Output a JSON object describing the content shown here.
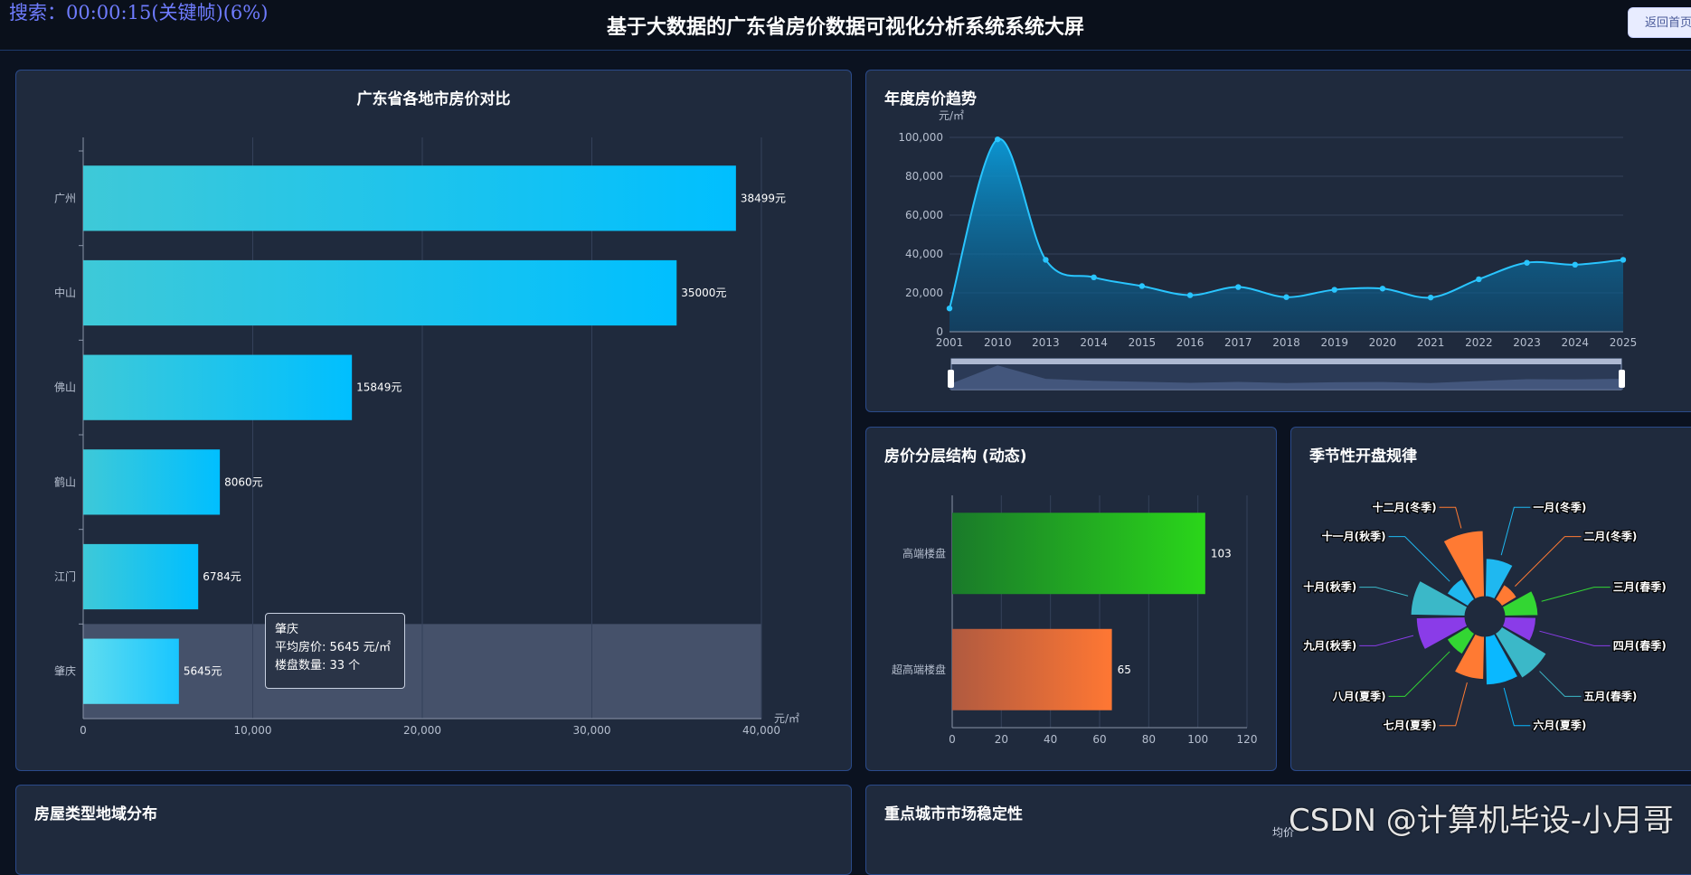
{
  "header": {
    "search_text": "搜索：00:00:15(关键帧)(6%)",
    "title": "基于大数据的广东省房价数据可视化分析系统系统大屏",
    "return_button": "返回首页"
  },
  "panels": {
    "city_compare_title": "广东省各地市房价对比",
    "trend_title": "年度房价趋势",
    "layer_title": "房价分层结构 (动态)",
    "season_title": "季节性开盘规律",
    "type_region_title": "房屋类型地域分布",
    "stability_title": "重点城市市场稳定性"
  },
  "tooltip": {
    "city": "肇庆",
    "price_line": "平均房价: 5645 元/㎡",
    "count_line": "楼盘数量: 33 个"
  },
  "watermark": "CSDN @计算机毕设-小月哥",
  "stability_legend": "均价",
  "colors": {
    "accent": "#00bfff",
    "panel_bg": "#1f2a3d",
    "border": "#2a4a8a"
  },
  "chart_data": [
    {
      "type": "bar",
      "orientation": "horizontal",
      "title": "广东省各地市房价对比",
      "categories": [
        "广州",
        "中山",
        "佛山",
        "鹤山",
        "江门",
        "肇庆"
      ],
      "values": [
        38499,
        35000,
        15849,
        8060,
        6784,
        5645
      ],
      "value_labels": [
        "38499元",
        "35000元",
        "15849元",
        "8060元",
        "6784元",
        "5645元"
      ],
      "xlabel": "元/㎡",
      "xlim": [
        0,
        40000
      ],
      "xticks": [
        "0",
        "10,000",
        "20,000",
        "30,000",
        "40,000"
      ],
      "highlight": "肇庆",
      "grid": true
    },
    {
      "type": "area",
      "title": "年度房价趋势",
      "ylabel": "元/㎡",
      "x": [
        "2001",
        "2010",
        "2013",
        "2014",
        "2015",
        "2016",
        "2017",
        "2018",
        "2019",
        "2020",
        "2021",
        "2022",
        "2023",
        "2024",
        "2025"
      ],
      "values": [
        12000,
        99000,
        37000,
        28000,
        23500,
        18800,
        23000,
        17800,
        21600,
        22200,
        17600,
        27000,
        35500,
        34500,
        37000
      ],
      "ylim": [
        0,
        100000
      ],
      "yticks": [
        "0",
        "20,000",
        "40,000",
        "60,000",
        "80,000",
        "100,000"
      ],
      "grid": true,
      "zoom_slider": true
    },
    {
      "type": "bar",
      "orientation": "horizontal",
      "title": "房价分层结构 (动态)",
      "categories": [
        "高端楼盘",
        "超高端楼盘"
      ],
      "values": [
        103,
        65
      ],
      "xlim": [
        0,
        120
      ],
      "xticks": [
        "0",
        "20",
        "40",
        "60",
        "80",
        "100",
        "120"
      ],
      "colors": [
        "#22cc22",
        "#ff7733"
      ]
    },
    {
      "type": "pie",
      "variant": "rose",
      "title": "季节性开盘规律",
      "categories": [
        "一月(冬季)",
        "二月(冬季)",
        "三月(春季)",
        "四月(春季)",
        "五月(春季)",
        "六月(夏季)",
        "七月(夏季)",
        "八月(夏季)",
        "九月(秋季)",
        "十月(秋季)",
        "十一月(秋季)",
        "十二月(冬季)"
      ],
      "values": [
        55,
        25,
        48,
        45,
        75,
        70,
        62,
        35,
        70,
        78,
        35,
        95
      ],
      "colors": [
        "#1fb8f0",
        "#ff7a33",
        "#33d633",
        "#8a3ce8",
        "#3bb8c8",
        "#0ab8ff",
        "#ff7a33",
        "#33d633",
        "#8a3ce8",
        "#3bb8c8",
        "#1fb8f0",
        "#ff7a33"
      ]
    }
  ]
}
